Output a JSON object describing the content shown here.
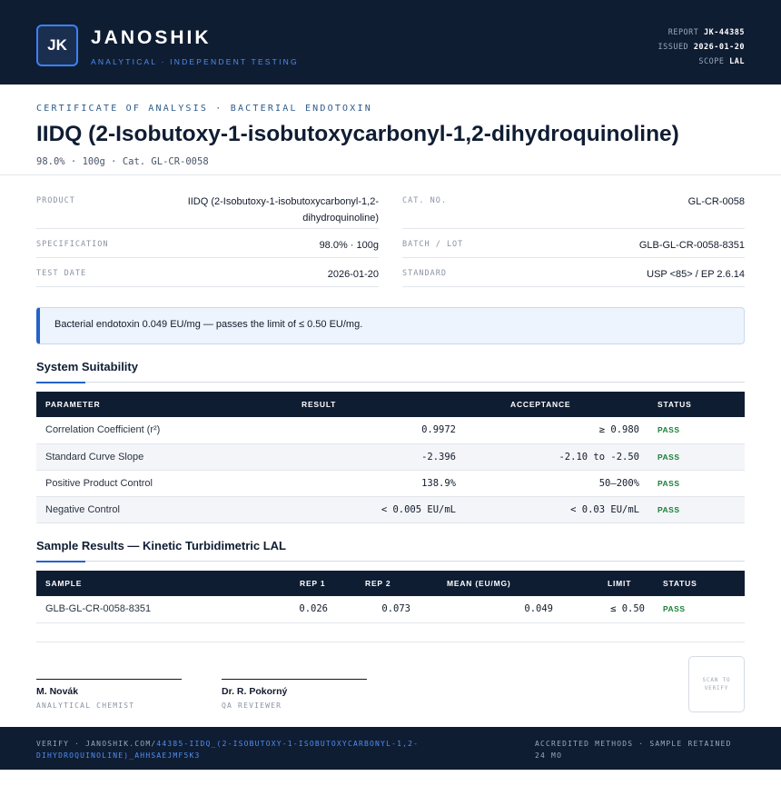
{
  "header": {
    "logo_initials": "JK",
    "brand": "JANOSHIK",
    "tagline": "ANALYTICAL · INDEPENDENT TESTING",
    "report_label": "REPORT",
    "report_value": "JK-44385",
    "issued_label": "ISSUED",
    "issued_value": "2026-01-20",
    "scope_label": "SCOPE",
    "scope_value": "LAL"
  },
  "certificate": {
    "eyebrow": "CERTIFICATE OF ANALYSIS · BACTERIAL ENDOTOXIN",
    "title": "IIDQ (2-Isobutoxy-1-isobutoxycarbonyl-1,2-dihydroquinoline)",
    "subline": "98.0% · 100g  ·  Cat. GL-CR-0058"
  },
  "info_left": [
    {
      "label": "PRODUCT",
      "value": "IIDQ (2-Isobutoxy-1-isobutoxycarbonyl-1,2-dihydroquinoline)"
    },
    {
      "label": "SPECIFICATION",
      "value": "98.0% · 100g"
    },
    {
      "label": "TEST DATE",
      "value": "2026-01-20"
    }
  ],
  "info_right": [
    {
      "label": "CAT. NO.",
      "value": "GL-CR-0058"
    },
    {
      "label": "BATCH / LOT",
      "value": "GLB-GL-CR-0058-8351"
    },
    {
      "label": "STANDARD",
      "value": "USP <85> / EP 2.6.14"
    }
  ],
  "callout": "Bacterial endotoxin 0.049 EU/mg — passes the limit of ≤ 0.50 EU/mg.",
  "system_suitability": {
    "title": "System Suitability",
    "headers": [
      "PARAMETER",
      "RESULT",
      "ACCEPTANCE",
      "STATUS"
    ],
    "rows": [
      {
        "parameter": "Correlation Coefficient (r²)",
        "result": "0.9972",
        "acceptance": "≥ 0.980",
        "status": "PASS"
      },
      {
        "parameter": "Standard Curve Slope",
        "result": "-2.396",
        "acceptance": "-2.10 to -2.50",
        "status": "PASS"
      },
      {
        "parameter": "Positive Product Control",
        "result": "138.9%",
        "acceptance": "50–200%",
        "status": "PASS"
      },
      {
        "parameter": "Negative Control",
        "result": "< 0.005 EU/mL",
        "acceptance": "< 0.03 EU/mL",
        "status": "PASS"
      }
    ]
  },
  "sample_results": {
    "title": "Sample Results — Kinetic Turbidimetric LAL",
    "headers": [
      "SAMPLE",
      "REP 1",
      "REP 2",
      "MEAN (EU/MG)",
      "LIMIT",
      "STATUS"
    ],
    "rows": [
      {
        "sample": "GLB-GL-CR-0058-8351",
        "rep1": "0.026",
        "rep2": "0.073",
        "mean": "0.049",
        "limit": "≤ 0.50",
        "status": "PASS"
      }
    ]
  },
  "signatures": [
    {
      "name": "M. Novák",
      "role": "ANALYTICAL CHEMIST"
    },
    {
      "name": "Dr. R. Pokorný",
      "role": "QA REVIEWER"
    }
  ],
  "qr_text": "SCAN TO VERIFY",
  "footer": {
    "verify_prefix": "VERIFY · JANOSHIK.COM/",
    "verify_link": "44385-IIDQ_(2-ISOBUTOXY-1-ISOBUTOXYCARBONYL-1,2-DIHYDROQUINOLINE)_AHHSAEJMF5K3",
    "right": "ACCREDITED METHODS · SAMPLE RETAINED 24 MO"
  }
}
